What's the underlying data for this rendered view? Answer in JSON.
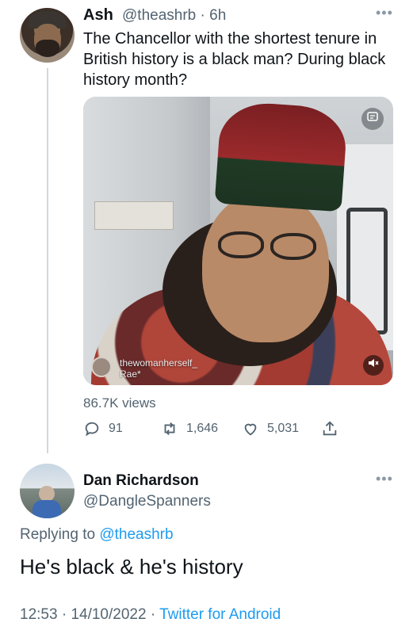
{
  "tweet": {
    "author_name": "Ash",
    "author_handle": "@theashrb",
    "separator": "·",
    "age": "6h",
    "more_icon": "ellipsis-icon",
    "text": "The Chancellor with the shortest tenure in British history is a black man? During black history month?",
    "media": {
      "creator_username": "thewomanherself_",
      "creator_name": "Rae*",
      "top_right_icon": "media-badge-icon",
      "bottom_right_icon": "mute-icon"
    },
    "views": "86.7K views",
    "actions": {
      "replies": "91",
      "retweets": "1,646",
      "likes": "5,031",
      "reply_icon": "reply-icon",
      "retweet_icon": "retweet-icon",
      "like_icon": "heart-icon",
      "share_icon": "share-icon"
    }
  },
  "reply": {
    "author_name": "Dan Richardson",
    "author_handle": "@DangleSpanners",
    "replying_to_prefix": "Replying to",
    "replying_to_handle": "@theashrb",
    "text": "He's black & he's history",
    "time": "12:53",
    "dot1": "·",
    "date": "14/10/2022",
    "dot2": "·",
    "source": "Twitter for Android"
  },
  "colors": {
    "accent": "#1d9bf0",
    "secondary_text": "#536471",
    "primary_text": "#0f1419",
    "thread_line": "#cfd9de"
  }
}
